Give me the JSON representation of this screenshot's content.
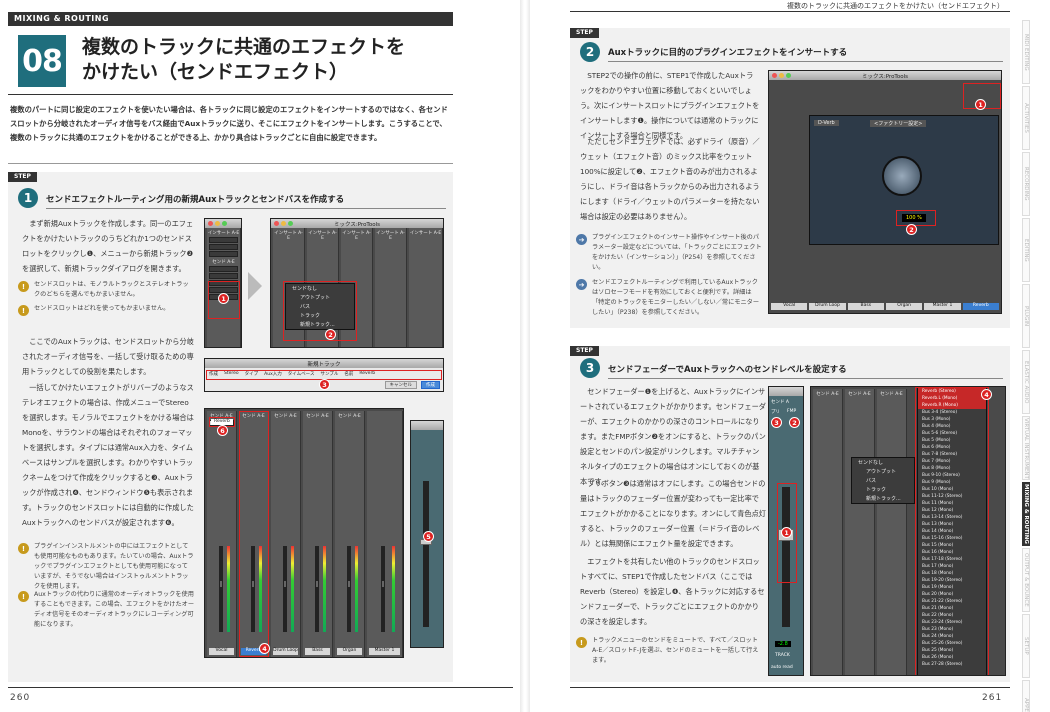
{
  "left": {
    "section_label": "MIXING & ROUTING",
    "chapter_number": "08",
    "title_line1": "複数のトラックに共通のエフェクトを",
    "title_line2": "かけたい（センドエフェクト）",
    "lead": "複数のパートに同じ設定のエフェクトを使いたい場合は、各トラックに同じ設定のエフェクトをインサートするのではなく、各センドスロットから分岐されたオーディオ信号をバス経由でAuxトラックに送り、そこにエフェクトをインサートします。こうすることで、複数のトラックに共通のエフェクトをかけることができる上、かかり具合はトラックごとに自由に設定できます。",
    "step": {
      "tag": "STEP",
      "number": "1",
      "title": "センドエフェクトルーティング用の新規Auxトラックとセンドバスを作成する",
      "para1": "まず新規Auxトラックを作成します。同一のエフェクトをかけたいトラックのうちどれか1つのセンドスロットをクリックし❶、メニューから新規トラック❷を選択して、新規トラックダイアログを開きます。",
      "note1": "センドスロットは、モノラルトラックとステレオトラックのどちらを選んでもかまいません。",
      "note2": "センドスロットはどれを使ってもかまいません。",
      "para2": "ここでのAuxトラックは、センドスロットから分岐されたオーディオ信号を、一括して受け取るための専用トラックとしての役割を果たします。",
      "para3": "一括してかけたいエフェクトがリバーブのようなステレオエフェクトの場合は、作成メニューでStereoを選択します。モノラルでエフェクトをかける場合はMonoを、サラウンドの場合はそれぞれのフォーマットを選択します。タイプには通常Aux入力を、タイムベースはサンプルを選択します。わかりやすいトラックネームをつけて作成をクリックすると❸、Auxトラックが作成され❹、センドウィンドウ❺も表示されます。トラックのセンドスロットには自動的に作成したAuxトラックへのセンドバスが設定されます❻。",
      "note3": "プラグインインストルメントの中にはエフェクトとしても使用可能なものもあります。たいていの場合、Auxトラックでプラグインエフェクトとしても使用可能になっていますが、そうでない場合はインストゥルメントトラックを使用します。",
      "note4": "Auxトラックの代わりに通常のオーディオトラックを使用することもできます。この場合、エフェクトをかけたオーディオ信号をそのオーディオトラックにレコーディング可能になります。"
    },
    "screens": {
      "mix_title": "ミックス:ProTools",
      "insert_label": "インサート A-E",
      "send_label": "センド A-E",
      "menu_items": [
        "センドなし",
        "アウトプット",
        "バス",
        "トラック",
        "新規トラック..."
      ],
      "dialog_title": "新規トラック",
      "dialog_fields": [
        "作成",
        "Stereo",
        "タイプ",
        "Aux入力",
        "タイムベース",
        "サンプル",
        "名前",
        "Reverb"
      ],
      "dialog_buttons": [
        "キャンセル",
        "作成"
      ],
      "send_slot": "Reverb",
      "track_names": [
        "Vocal",
        "Reverb",
        "Drum Loop",
        "Bass",
        "Organ",
        "Master 1"
      ],
      "io_labels": [
        "Input 1",
        "Output1-2"
      ],
      "auto_label": "auto read",
      "group_label": "no group",
      "markers": [
        "1",
        "2",
        "3",
        "4",
        "5",
        "6"
      ]
    },
    "page_number": "260"
  },
  "right": {
    "running_head": "複数のトラックに共通のエフェクトをかけたい（センドエフェクト）",
    "step2": {
      "tag": "STEP",
      "number": "2",
      "title": "Auxトラックに目的のプラグインエフェクトをインサートする",
      "para1": "STEP2での操作の前に、STEP1で作成したAuxトラックをわかりやすい位置に移動しておくといいでしょう。次にインサートスロットにプラグインエフェクトをインサートします❶。操作については通常のトラックにインサートする場合と同様です。",
      "para2": "ただしセンドエフェクトでは、必ずドライ（原音）／ウェット（エフェクト音）のミックス比率をウェット100%に設定して❷、エフェクト音のみが出力されるようにし、ドライ音は各トラックからのみ出力されるようにします（ドライ／ウェットのパラメーターを持たない場合は設定の必要はありません）。",
      "note1": "プラグインエフェクトのインサート操作やインサート後のパラメーター設定などについては、「トラックごとにエフェクトをかけたい（インサーション）」（P254）を参照してください。",
      "note2": "センドエフェクトルーティングで利用しているAuxトラックはソロセーフモードを有効にしておくと便利です。詳細は「特定のトラックをモニターしたい／しない／常にモニターしたい」（P238）を参照してください。",
      "screen_title": "ミックス:ProTools",
      "plugin_name": "D-Verb",
      "plugin_preset": "<ファクトリー設定>",
      "wet_value": "100 %",
      "tracks": [
        "Vocal",
        "Drum Loop",
        "Bass",
        "Organ",
        "Master 1",
        "Reverb"
      ]
    },
    "step3": {
      "tag": "STEP",
      "number": "3",
      "title": "センドフェーダーでAuxトラックへのセンドレベルを設定する",
      "para1": "センドフェーダー❶を上げると、Auxトラックにインサートされているエフェクトがかかります。センドフェーダーが、エフェクトのかかりの深さのコントロールになります。またFMPボタン❷をオンにすると、トラックのパン設定とセンドのパン設定がリンクします。マルチチャンネルタイプのエフェクトの場合はオンにしておくのが基本です。",
      "para2": "プリボタン❸は通常はオフにします。この場合センドの量はトラックのフェーダー位置が変わっても一定比率でエフェクトがかかることになります。オンにして青色点灯すると、トラックのフェーダー位置（＝ドライ音のレベル）とは無関係にエフェクト量を設定できます。",
      "para3": "エフェクトを共有したい他のトラックのセンドスロットすべてに、STEP1で作成したセンドバス（ここではReverb（Stereo）を設定し❹、各トラックに対応するセンドフェーダーで、トラックごとにエフェクトのかかりの深さを設定します。",
      "note1": "トラックメニューのセンドをミュートで、すべて／スロットA-E／スロットF-Jを選ぶ、センドのミュートを一括して行えます。",
      "send_value": "-2.8",
      "bus_list": [
        "Reverb (Stereo)",
        "Reverb.L (Mono)",
        "Reverb.R (Mono)",
        "Bus 3-4 (Stereo)",
        "Bus 3 (Mono)",
        "Bus 4 (Mono)",
        "Bus 5-6 (Stereo)",
        "Bus 5 (Mono)",
        "Bus 6 (Mono)",
        "Bus 7-8 (Stereo)",
        "Bus 7 (Mono)",
        "Bus 8 (Mono)",
        "Bus 9-10 (Stereo)",
        "Bus 9 (Mono)",
        "Bus 10 (Mono)",
        "Bus 11-12 (Stereo)",
        "Bus 11 (Mono)",
        "Bus 12 (Mono)",
        "Bus 13-14 (Stereo)",
        "Bus 13 (Mono)",
        "Bus 14 (Mono)",
        "Bus 15-16 (Stereo)",
        "Bus 15 (Mono)",
        "Bus 16 (Mono)",
        "Bus 17-18 (Stereo)",
        "Bus 17 (Mono)",
        "Bus 18 (Mono)",
        "Bus 19-20 (Stereo)",
        "Bus 19 (Mono)",
        "Bus 20 (Mono)",
        "Bus 21-22 (Stereo)",
        "Bus 21 (Mono)",
        "Bus 22 (Mono)",
        "Bus 23-24 (Stereo)",
        "Bus 23 (Mono)",
        "Bus 24 (Mono)",
        "Bus 25-26 (Stereo)",
        "Bus 25 (Mono)",
        "Bus 26 (Mono)",
        "Bus 27-28 (Stereo)"
      ],
      "send_window_labels": [
        "センド A",
        "セーフ",
        "プリ",
        "FMP",
        "TRACK",
        "AUTO",
        "auto read"
      ]
    },
    "side_tabs": [
      "MIDI EDITING",
      "ACTIVITIES",
      "RECORDING",
      "EDITING",
      "PLUGIN",
      "ELASTIC AUDIO",
      "VIRTUAL INSTRUMENT",
      "MIXING & ROUTING",
      "OUTPUT & BOUNCE",
      "SETUP",
      "APPENDIX"
    ],
    "page_number": "261"
  }
}
